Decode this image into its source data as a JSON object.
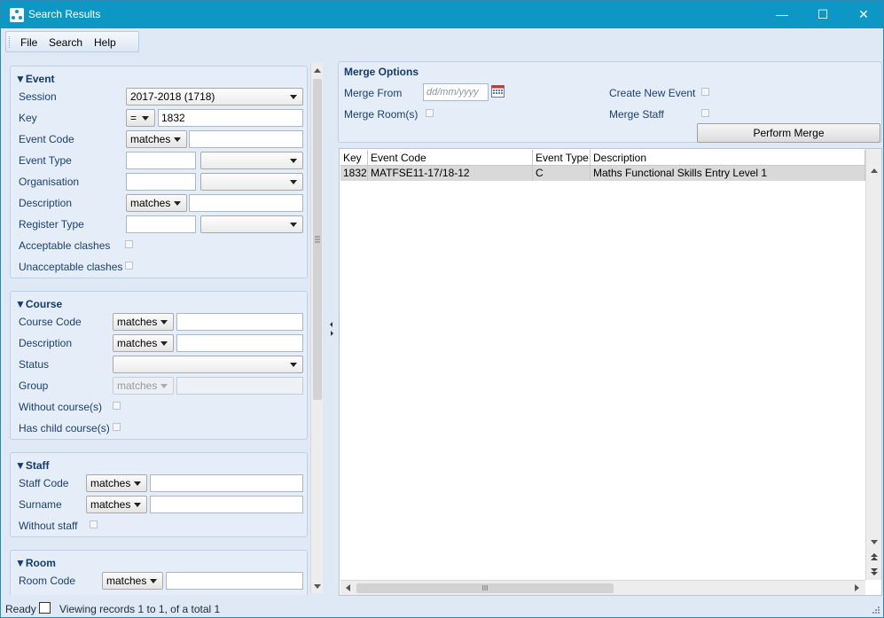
{
  "window": {
    "title": "Search Results",
    "minimize": "—",
    "maximize": "☐",
    "close": "✕"
  },
  "menu": {
    "file": "File",
    "search": "Search",
    "help": "Help"
  },
  "event": {
    "heading": "▼Event",
    "session_label": "Session",
    "session_value": "2017-2018 (1718)",
    "key_label": "Key",
    "key_op": "=",
    "key_value": "1832",
    "event_code_label": "Event Code",
    "event_code_op": "matches",
    "event_code_value": "",
    "event_type_label": "Event Type",
    "event_type_value": "",
    "organisation_label": "Organisation",
    "organisation_value": "",
    "description_label": "Description",
    "description_op": "matches",
    "description_value": "",
    "register_type_label": "Register Type",
    "register_type_value": "",
    "acceptable_clashes_label": "Acceptable clashes",
    "unacceptable_clashes_label": "Unacceptable clashes"
  },
  "course": {
    "heading": "▼Course",
    "course_code_label": "Course Code",
    "course_code_op": "matches",
    "course_code_value": "",
    "description_label": "Description",
    "description_op": "matches",
    "description_value": "",
    "status_label": "Status",
    "status_value": "",
    "group_label": "Group",
    "group_op": "matches",
    "group_value": "",
    "without_courses_label": "Without course(s)",
    "has_child_label": "Has child course(s)"
  },
  "staff": {
    "heading": "▼Staff",
    "staff_code_label": "Staff Code",
    "staff_code_op": "matches",
    "staff_code_value": "",
    "surname_label": "Surname",
    "surname_op": "matches",
    "surname_value": "",
    "without_staff_label": "Without staff"
  },
  "room": {
    "heading": "▼Room",
    "room_code_label": "Room Code",
    "room_code_op": "matches",
    "room_code_value": ""
  },
  "merge": {
    "heading": "Merge Options",
    "merge_from_label": "Merge From",
    "merge_from_placeholder": "dd/mm/yyyy",
    "merge_rooms_label": "Merge Room(s)",
    "create_new_event_label": "Create New Event",
    "merge_staff_label": "Merge Staff",
    "perform_merge_label": "Perform Merge"
  },
  "grid": {
    "columns": [
      "Key",
      "Event Code",
      "Event Type",
      "Description"
    ],
    "rows": [
      {
        "key": "1832",
        "event_code": "MATFSE11-17/18-12",
        "event_type": "C",
        "description": "Maths Functional Skills Entry Level 1"
      }
    ],
    "hscroll_grip": "III"
  },
  "status": {
    "ready": "Ready",
    "records": "Viewing records 1 to 1, of a total 1"
  },
  "colors": {
    "titlebar": "#0c97c4",
    "panel": "#e4edf8",
    "heading": "#153a6e",
    "selected_row": "#d9d9d9"
  }
}
